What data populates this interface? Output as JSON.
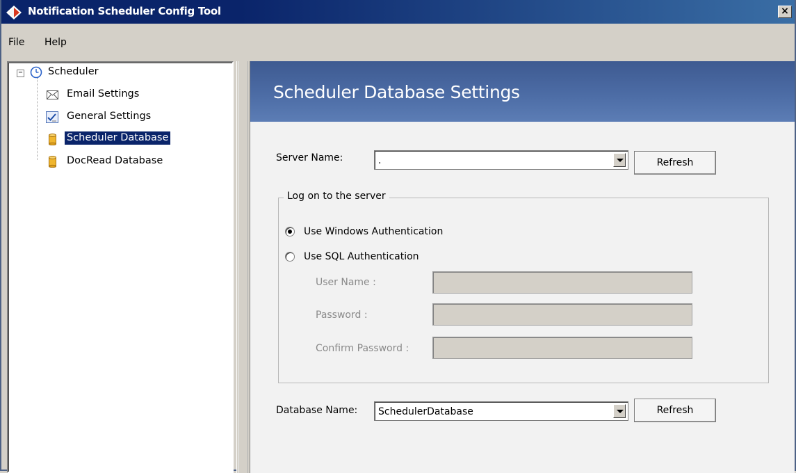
{
  "window": {
    "title": "Notification Scheduler Config Tool",
    "close_glyph": "×"
  },
  "menu": {
    "file": "File",
    "help": "Help"
  },
  "tree": {
    "expander_glyph": "−",
    "root": {
      "label": "Scheduler",
      "icon": "clock-icon"
    },
    "items": [
      {
        "label": "Email Settings",
        "icon": "envelope-icon"
      },
      {
        "label": "General Settings",
        "icon": "checklist-icon"
      },
      {
        "label": "Scheduler Database",
        "icon": "database-icon",
        "selected": true
      },
      {
        "label": "DocRead Database",
        "icon": "database-icon"
      }
    ]
  },
  "content": {
    "banner_title": "Scheduler Database Settings",
    "server": {
      "label": "Server Name:",
      "value": ".",
      "refresh_label": "Refresh"
    },
    "logon_group": {
      "title": "Log on to the server",
      "windows_auth_label": "Use Windows Authentication",
      "windows_auth_selected": true,
      "sql_auth_label": "Use SQL Authentication",
      "sql_auth_selected": false,
      "username_label": "User Name :",
      "password_label": "Password :",
      "confirm_password_label": "Confirm Password :"
    },
    "database": {
      "label": "Database Name:",
      "value": "SchedulerDatabase",
      "refresh_label": "Refresh"
    }
  },
  "colors": {
    "title_bar": "#0a246a",
    "banner": "#4c6ca5",
    "selection": "#0a246a"
  }
}
